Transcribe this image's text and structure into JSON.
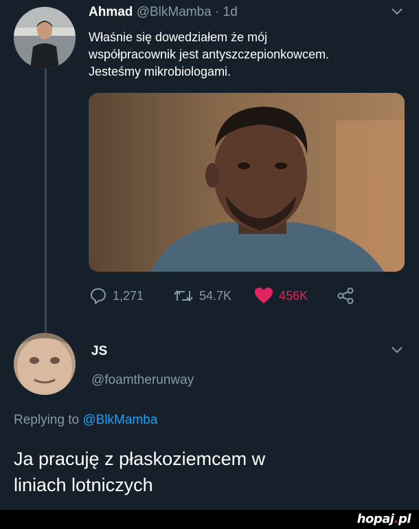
{
  "tweet": {
    "author_name": "Ahmad",
    "author_handle": "@BlkMamba",
    "separator": "·",
    "time": "1d",
    "text_lines": [
      "Właśnie się dowedziałem że mój",
      "współpracownik jest antyszczepionkowcem.",
      "Jesteśmy mikrobiologami."
    ],
    "replies": "1,271",
    "retweets": "54.7K",
    "likes": "456K"
  },
  "reply": {
    "author_name": "JS",
    "author_handle": "@foamtherunway",
    "replying_prefix": "Replying to",
    "replying_handle": "@BlkMamba",
    "text_lines": [
      "Ja pracuję z płaskoziemcem w",
      "liniach lotniczych"
    ]
  },
  "watermark": {
    "text": "hopaj",
    "dot": ".",
    "tld": "pl"
  },
  "icons": {
    "reply": "speech-bubble-icon",
    "retweet": "retweet-icon",
    "like": "heart-icon",
    "share": "share-icon",
    "menu": "chevron-down-icon"
  },
  "colors": {
    "background": "#15202b",
    "muted": "#8899a6",
    "link": "#1da1f2",
    "like": "#e0245e"
  }
}
